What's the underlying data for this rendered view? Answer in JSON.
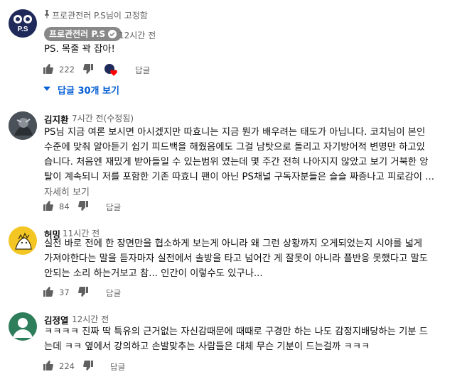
{
  "pinned": {
    "pinned_label": "프로관전러 P.S님이 고정함",
    "avatar_text": "P.S",
    "author": "프로관전러 P.S",
    "time": "12시간 전",
    "text": "PS. 목줄 꽉 잡아!",
    "likes": "222",
    "reply_label": "답글",
    "view_replies": "답글 30개 보기"
  },
  "comments": [
    {
      "author": "김지환",
      "time": "7시간 전(수정됨)",
      "lines": [
        "PS님 지금 여론 보시면 아시겠지만 따효니는 지금 뭔가 배우려는 태도가 아닙니다. 코치님이 본인",
        "수준에 맞춰 알아듣기 쉽기 피드백을 해줬음에도 그걸 남탓으로 돌리고 자기방어적 변명만 하고있",
        "습니다. 처음엔 재밌게 받아들일 수 있는범위 였는데 몇 주간 전혀 나아지지 않았고 보기 거북한 앙",
        "탈이 계속되니 저를 포함한 기존 따효니 팬이 아닌 PS채널 구독자분들은 슬슬 짜증나고 피로감이 ..."
      ],
      "read_more": "자세히 보기",
      "likes": "84",
      "reply_label": "답글"
    },
    {
      "author": "허밍",
      "time": "11시간 전",
      "lines": [
        "실전 바로 전에  한 장면만을 협소하게 보는게 아니라 왜 그런 상황까지 오게되었는지 시야를 넓게",
        "가져야한다는 말을 듣자마자 실전에서 솔방을 타고 넘어간 게 잘못이 아니라 플반응 못했다고 말도",
        "안되는 소리 하는거보고 참... 인간이 이렇수도 있구나..."
      ],
      "likes": "37",
      "reply_label": "답글"
    },
    {
      "author": "김정열",
      "time": "12시간 전",
      "lines": [
        "ㅋㅋㅋㅋ 진짜 딱 특유의 근거없는 자신감때문에 때때로 구경만 하는 나도 감정지배당하는 기분 드",
        "는데 ㅋㅋ 옆에서 강의하고 손발맞추는 사람들은 대체 무슨 기분이 드는걸까 ㅋㅋㅋ"
      ],
      "likes": "224",
      "reply_label": "답글"
    }
  ],
  "colors": {
    "link_blue": "#065fd4",
    "heart_red": "#ff0000",
    "pinned_avatar_bg": "#1f2a5a",
    "humming_avatar_bg": "#f3c623",
    "jy_avatar_bg": "#2e7d5b"
  }
}
